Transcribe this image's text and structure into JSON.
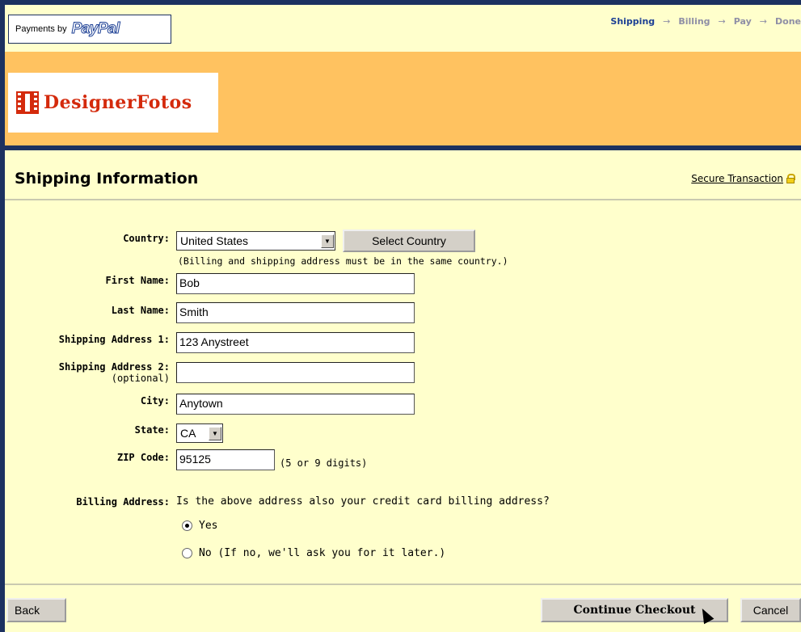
{
  "header": {
    "payments_by": "Payments by",
    "paypal_logo": "PayPal",
    "merchant_name": "DesignerFotos",
    "steps": [
      "Shipping",
      "Billing",
      "Pay",
      "Done"
    ],
    "arrow": "→",
    "banner_color": "#ffc260"
  },
  "page": {
    "title": "Shipping Information",
    "secure_link": "Secure Transaction",
    "icons": {
      "lock": "lock-icon",
      "film": "film-strip-icon",
      "dropdown": "chevron-down-icon"
    }
  },
  "form": {
    "country_label": "Country:",
    "country_value": "United States",
    "select_country_button": "Select Country",
    "country_note": "(Billing and shipping address must be in the same country.)",
    "first_name_label": "First Name:",
    "first_name_value": "Bob",
    "last_name_label": "Last Name:",
    "last_name_value": "Smith",
    "address1_label": "Shipping Address 1:",
    "address1_value": "123 Anystreet",
    "address2_label": "Shipping Address 2:",
    "address2_optional": "(optional)",
    "address2_value": "",
    "city_label": "City:",
    "city_value": "Anytown",
    "state_label": "State:",
    "state_value": "CA",
    "zip_label": "ZIP Code:",
    "zip_value": "95125",
    "zip_hint": "(5 or 9 digits)",
    "billing_label": "Billing Address:",
    "billing_question": "Is the above address also your credit card billing address?",
    "billing_yes": "Yes",
    "billing_no": "No (If no, we'll ask you for it later.)",
    "billing_selected": "Yes"
  },
  "footer": {
    "back_button": "Back",
    "continue_button": "Continue Checkout",
    "cancel_button": "Cancel"
  }
}
